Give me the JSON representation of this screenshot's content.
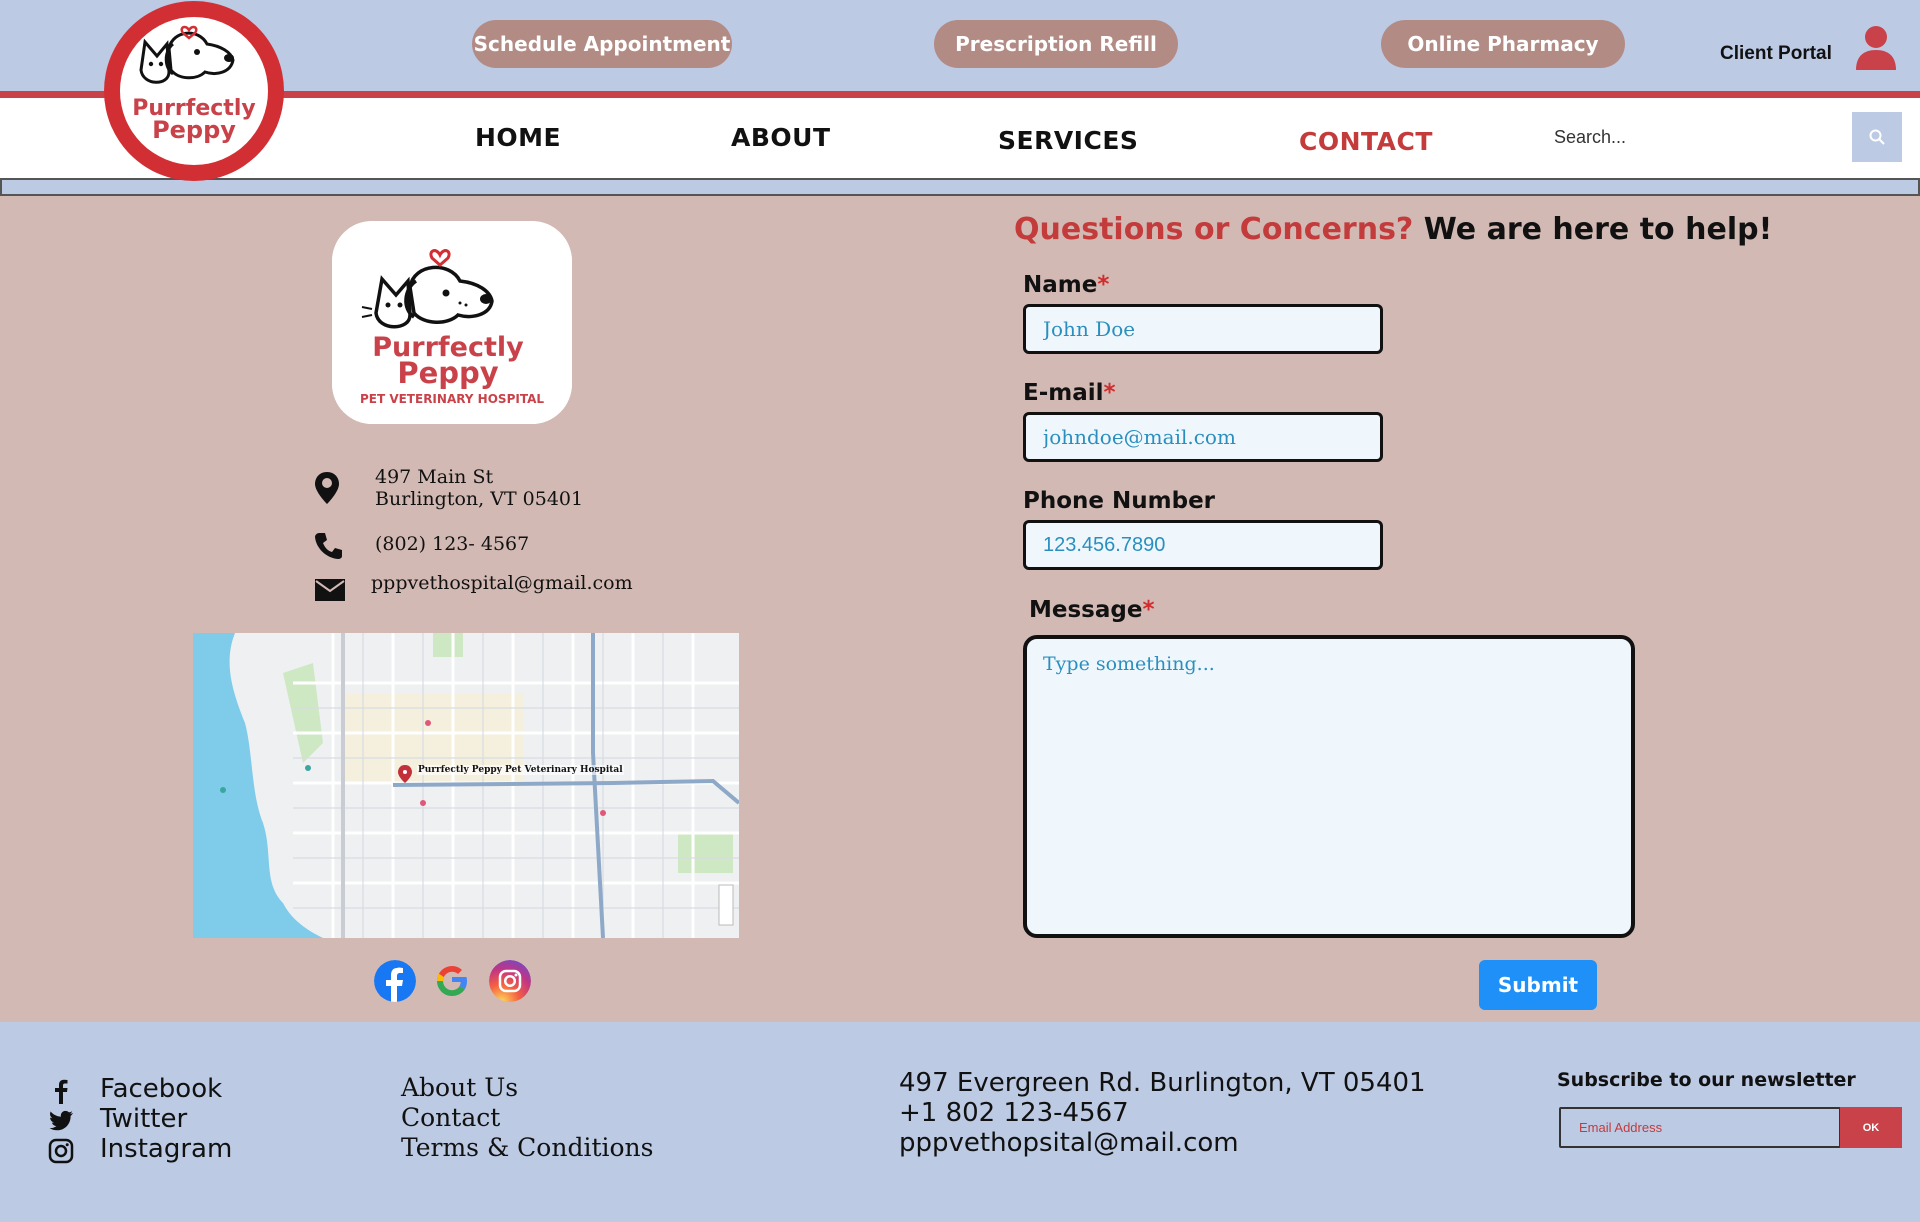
{
  "header": {
    "pills": {
      "schedule": "Schedule Appointment",
      "refill": "Prescription Refill",
      "pharmacy": "Online Pharmacy"
    },
    "client_portal": "Client Portal",
    "user_icon": "user-icon"
  },
  "logo": {
    "title_line1": "Purrfectly",
    "title_line2": "Peppy",
    "subtitle": "PET VETERINARY HOSPITAL"
  },
  "nav": {
    "home": "HOME",
    "about": "ABOUT",
    "services": "SERVICES",
    "contact": "CONTACT",
    "search_placeholder": "Search..."
  },
  "contact_info": {
    "address_line1": "497 Main St",
    "address_line2": "Burlington, VT 05401",
    "phone": "(802) 123- 4567",
    "email": "pppvethospital@gmail.com",
    "map_pin_label": "Purrfectly Peppy Pet Veterinary Hospital"
  },
  "social_icons": [
    "facebook-icon",
    "google-icon",
    "instagram-icon"
  ],
  "form": {
    "heading_highlight": "Questions or Concerns?",
    "heading_rest": " We are here to help!",
    "name_label": "Name",
    "name_placeholder": "John Doe",
    "email_label": "E-mail",
    "email_placeholder": "johndoe@mail.com",
    "phone_label": "Phone Number",
    "phone_placeholder": "123.456.7890",
    "message_label": "Message",
    "message_placeholder": "Type something...",
    "required_mark": "*",
    "submit": "Submit"
  },
  "footer": {
    "social": {
      "facebook": "Facebook",
      "twitter": "Twitter",
      "instagram": "Instagram"
    },
    "links": {
      "about": "About Us",
      "contact": "Contact",
      "terms": "Terms & Conditions"
    },
    "info": {
      "address": "497 Evergreen Rd. Burlington, VT 05401",
      "phone": "+1 802 123-4567",
      "email": "pppvethopsital@mail.com"
    },
    "newsletter": {
      "title": "Subscribe to our newsletter",
      "placeholder": "Email Address",
      "button": "OK"
    }
  },
  "colors": {
    "header_bg": "#bccae4",
    "accent_red": "#c9424a",
    "pill_bg": "#b38b85",
    "section_bg": "#d2b9b4",
    "submit_blue": "#1e90f7"
  }
}
